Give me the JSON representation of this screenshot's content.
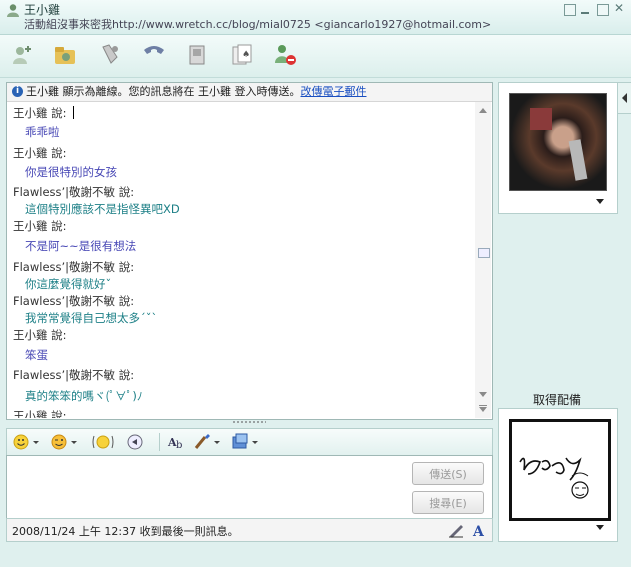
{
  "window": {
    "contact_name": "王小雞",
    "subtitle": "活動組沒事來密我http://www.wretch.cc/blog/mial0725 <giancarlo1927@hotmail.com>"
  },
  "toolbar": {
    "icons": [
      "invite-contact-icon",
      "share-files-icon",
      "voice-call-icon",
      "phone-call-icon",
      "video-icon",
      "games-icon",
      "block-contact-icon"
    ]
  },
  "infobar": {
    "text": "王小雞 顯示為離線。您的訊息將在 王小雞 登入時傳送。",
    "link": "改傳電子郵件"
  },
  "messages": [
    {
      "speaker": "王小雞 說:",
      "text": "乖乖啦",
      "side": "other"
    },
    {
      "speaker": "王小雞 說:",
      "text": "你是很特別的女孩",
      "side": "other"
    },
    {
      "speaker": "Flawless’|敬謝不敏 說:",
      "text": "這個特別應該不是指怪異吧XD",
      "side": "me"
    },
    {
      "speaker": "王小雞 說:",
      "text": "不是阿~~是很有想法",
      "side": "other"
    },
    {
      "speaker": "Flawless’|敬謝不敏 說:",
      "text": "你這麼覺得就好ˇ",
      "side": "me"
    },
    {
      "speaker": "Flawless’|敬謝不敏 說:",
      "text": "我常常覺得自己想太多ˊˇˋ",
      "side": "me"
    },
    {
      "speaker": "王小雞 說:",
      "text": "笨蛋",
      "side": "other"
    },
    {
      "speaker": "Flawless’|敬謝不敏 說:",
      "text": "真的笨笨的嗎ヾ(ﾟ∀ﾟ)ﾉ",
      "side": "me"
    },
    {
      "speaker": "王小雞 說:",
      "text": "",
      "side": "other"
    }
  ],
  "format_toolbar": {
    "icons": [
      "emoticon-icon",
      "wink-icon",
      "nudge-icon",
      "voice-clip-icon",
      "font-icon",
      "background-icon",
      "send-image-icon"
    ]
  },
  "input": {
    "value": "",
    "send_label": "傳送(S)",
    "search_label": "搜尋(E)"
  },
  "status": {
    "text": "2008/11/24 上午 12:37 收到最後一則訊息。"
  },
  "right_panel": {
    "signature_label": "取得配備"
  },
  "colors": {
    "accent": "#1c7f86",
    "other_text": "#4747b5",
    "link": "#1a4fc1"
  }
}
